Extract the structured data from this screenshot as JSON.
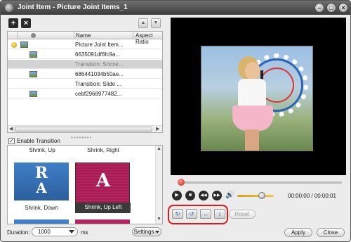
{
  "window": {
    "title": "Joint Item - Picture Joint Items_1",
    "minimize": "–",
    "maximize": "□",
    "close": "×"
  },
  "toolbar": {
    "add": "+",
    "remove": "×",
    "move_up": "▲",
    "move_down": "▼"
  },
  "list": {
    "columns": [
      "Name",
      "Aspect Ratio"
    ],
    "rows": [
      {
        "name": "Picture Joint Item...",
        "type": "group",
        "selected": false
      },
      {
        "name": "6635091df6fc9a...",
        "type": "image",
        "selected": false
      },
      {
        "name": "Transition: Shrink...",
        "type": "transition",
        "selected": true
      },
      {
        "name": "686441034b50ae...",
        "type": "image",
        "selected": false
      },
      {
        "name": "Transition: Slide ...",
        "type": "transition",
        "selected": false
      },
      {
        "name": "cebf2968977482...",
        "type": "image",
        "selected": false
      }
    ],
    "splitter": "••••••••"
  },
  "transition": {
    "enable_label": "Enable Transition",
    "enabled": true,
    "check_mark": "✓",
    "tiles": [
      {
        "top_label": "Shrink, Up",
        "letters": [
          "R",
          "A"
        ],
        "caption": "Shrink, Down",
        "color": "blue"
      },
      {
        "top_label": "Shrink, Right",
        "letters": [
          "A"
        ],
        "caption": "Shrink, Up Left",
        "color": "pink",
        "selected": true
      }
    ]
  },
  "duration": {
    "label": "Duration:",
    "value": "1000",
    "unit": "ms"
  },
  "settings_label": "Settings",
  "player": {
    "time": "00:00:00 / 00:00:01",
    "progress": 0.0,
    "volume": 0.6,
    "play": "▶",
    "stop": "■",
    "prev": "◀◀",
    "next": "▶▶",
    "volume_icon": "🔊"
  },
  "rotate": {
    "rotate_right": "↻",
    "rotate_left": "↺",
    "flip_horizontal": "↔",
    "flip_vertical": "↕",
    "reset_label": "Reset"
  },
  "actions": {
    "apply": "Apply",
    "close": "Close"
  },
  "colors": {
    "highlight_ring": "#e0181a",
    "titlebar": "#3c3c3c",
    "timeline_knob": "#c21c12"
  }
}
